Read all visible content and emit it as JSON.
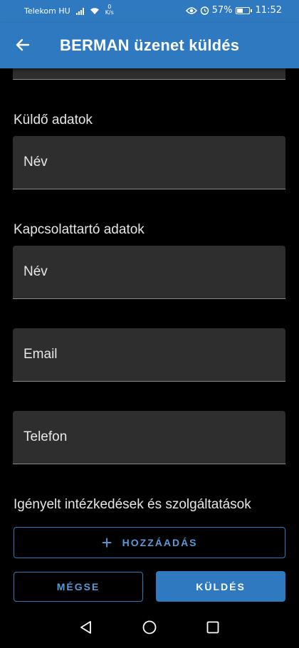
{
  "status_bar": {
    "carrier": "Telekom HU",
    "speed_value": "0",
    "speed_unit": "K/s",
    "battery_percent": "57%",
    "battery_level": 0.57,
    "time": "11:52"
  },
  "app_bar": {
    "title": "BERMAN üzenet küldés"
  },
  "sender": {
    "label": "Küldő adatok",
    "name_placeholder": "Név"
  },
  "contact": {
    "label": "Kapcsolattartó adatok",
    "name_placeholder": "Név",
    "email_placeholder": "Email",
    "phone_placeholder": "Telefon"
  },
  "services": {
    "label": "Igényelt intézkedések és szolgáltatások",
    "add_label": "HOZZÁADÁS"
  },
  "actions": {
    "cancel_label": "MÉGSE",
    "send_label": "KÜLDÉS"
  },
  "colors": {
    "primary": "#2e79c0",
    "field_bg": "#2e2e2e",
    "background": "#000000"
  },
  "icons": {
    "back": "arrow-left-icon",
    "add": "plus-icon",
    "nav_back": "triangle-back-icon",
    "nav_home": "circle-home-icon",
    "nav_recents": "square-recents-icon"
  }
}
